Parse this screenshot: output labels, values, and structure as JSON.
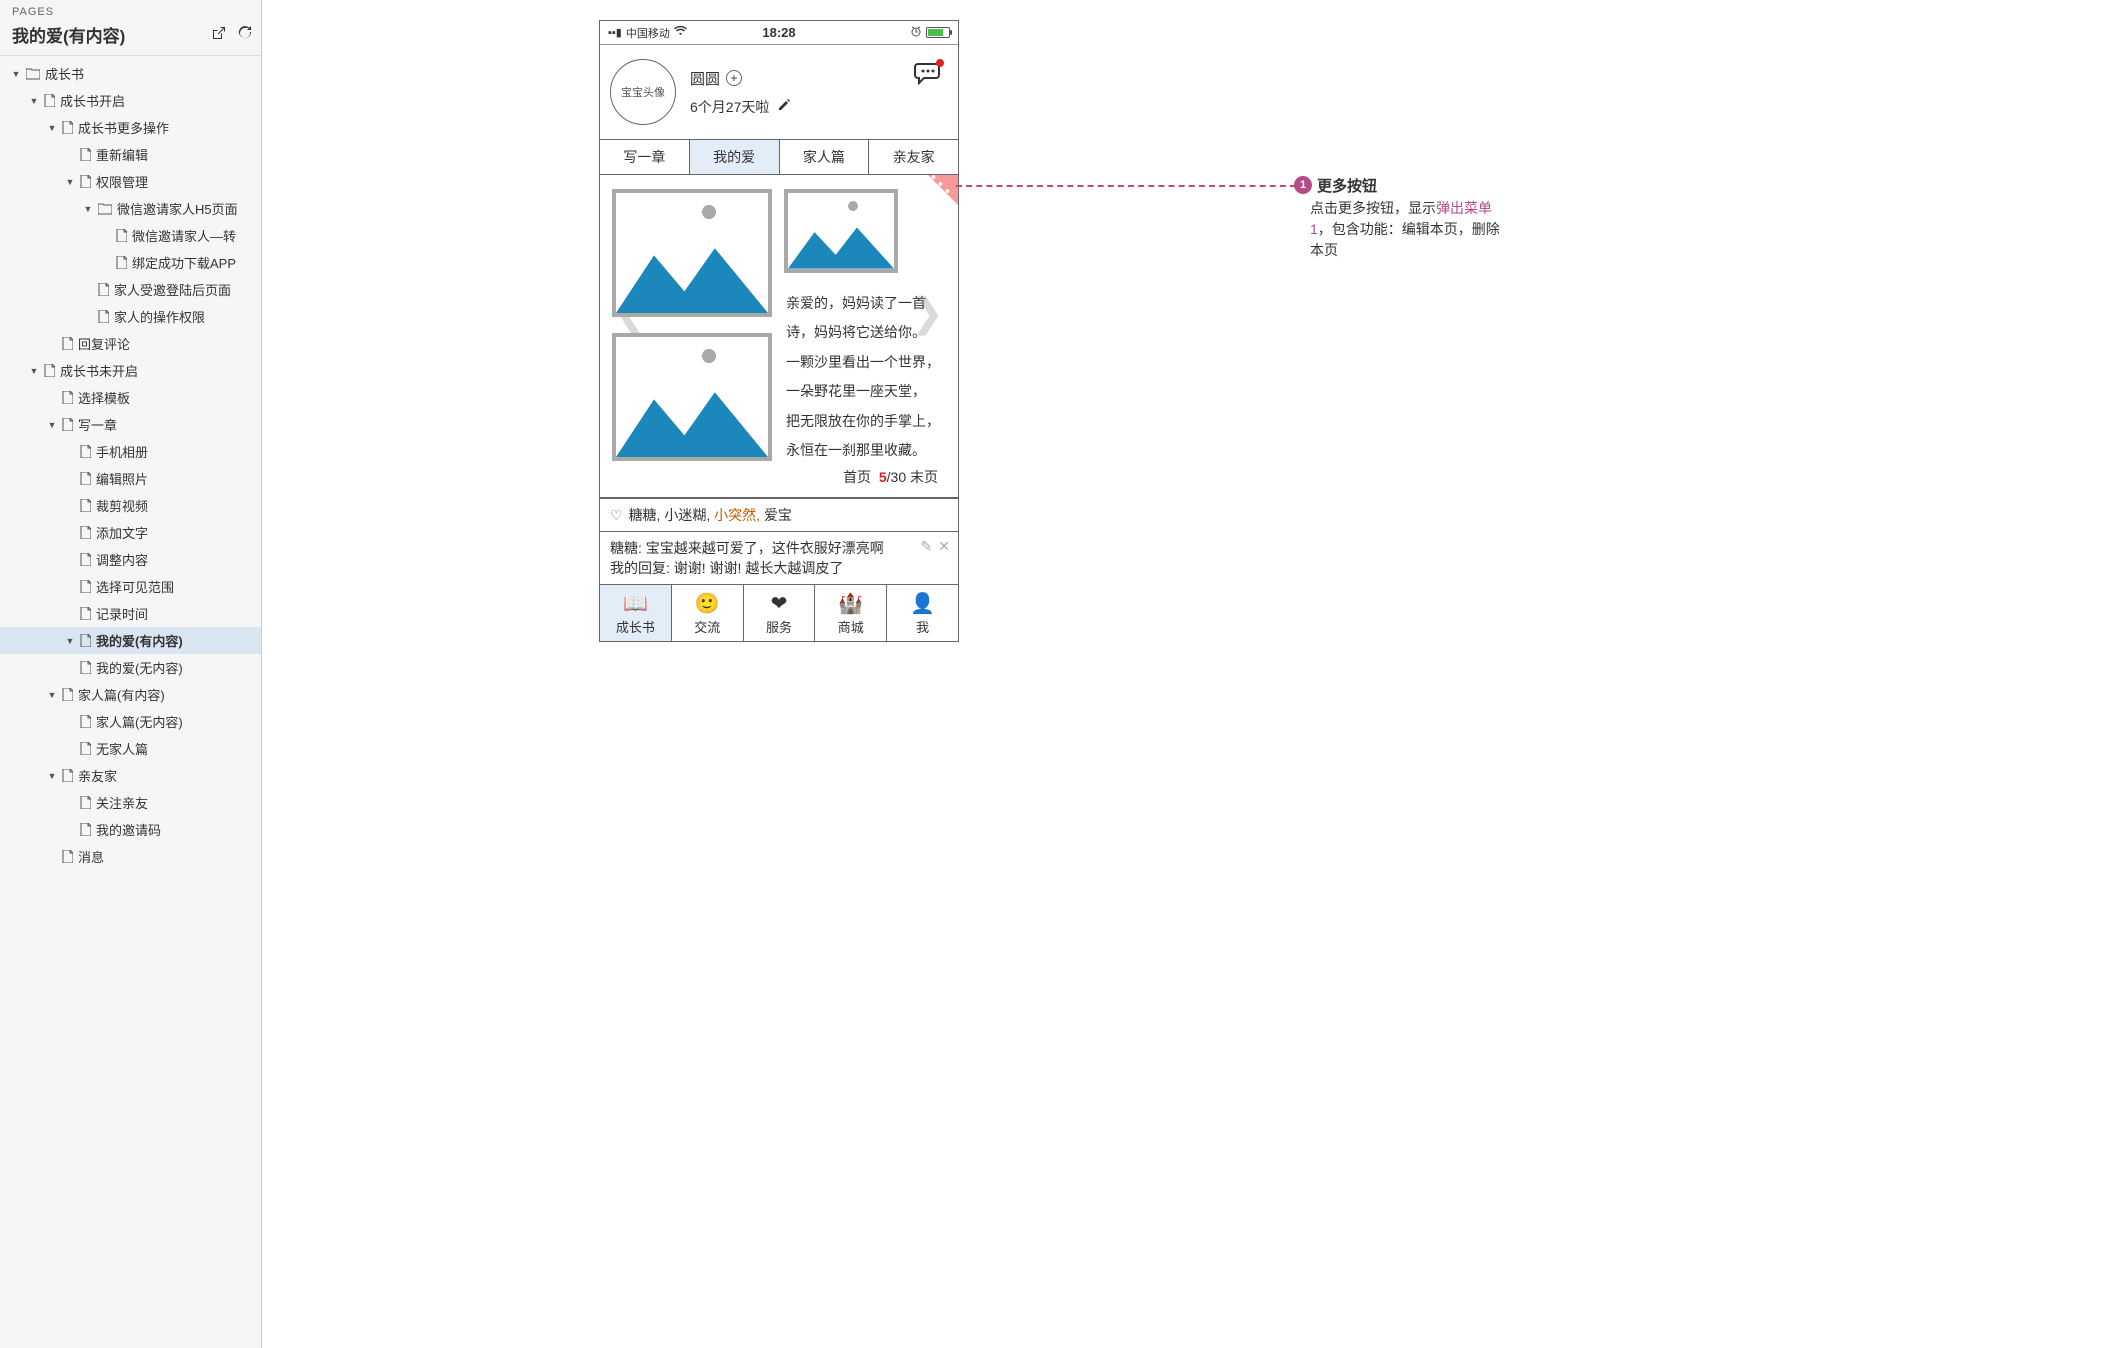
{
  "sidebar": {
    "header": "PAGES",
    "title": "我的爱(有内容)",
    "tree": [
      {
        "d": 0,
        "t": "folder",
        "label": "成长书",
        "exp": true
      },
      {
        "d": 1,
        "t": "page",
        "label": "成长书开启",
        "exp": true
      },
      {
        "d": 2,
        "t": "page",
        "label": "成长书更多操作",
        "exp": true
      },
      {
        "d": 3,
        "t": "page",
        "label": "重新编辑"
      },
      {
        "d": 3,
        "t": "page",
        "label": "权限管理",
        "exp": true
      },
      {
        "d": 4,
        "t": "folder",
        "label": "微信邀请家人H5页面",
        "exp": true
      },
      {
        "d": 5,
        "t": "page",
        "label": "微信邀请家人—转"
      },
      {
        "d": 5,
        "t": "page",
        "label": "绑定成功下载APP"
      },
      {
        "d": 4,
        "t": "page",
        "label": "家人受邀登陆后页面"
      },
      {
        "d": 4,
        "t": "page",
        "label": "家人的操作权限"
      },
      {
        "d": 2,
        "t": "page",
        "label": "回复评论"
      },
      {
        "d": 1,
        "t": "page",
        "label": "成长书未开启",
        "exp": true
      },
      {
        "d": 2,
        "t": "page",
        "label": "选择模板"
      },
      {
        "d": 2,
        "t": "page",
        "label": "写一章",
        "exp": true
      },
      {
        "d": 3,
        "t": "page",
        "label": "手机相册"
      },
      {
        "d": 3,
        "t": "page",
        "label": "编辑照片"
      },
      {
        "d": 3,
        "t": "page",
        "label": "裁剪视频"
      },
      {
        "d": 3,
        "t": "page",
        "label": "添加文字"
      },
      {
        "d": 3,
        "t": "page",
        "label": "调整内容"
      },
      {
        "d": 3,
        "t": "page",
        "label": "选择可见范围"
      },
      {
        "d": 3,
        "t": "page",
        "label": "记录时间"
      },
      {
        "d": 3,
        "t": "page",
        "label": "我的爱(有内容)",
        "exp": true,
        "selected": true
      },
      {
        "d": 3,
        "t": "page",
        "label": "我的爱(无内容)"
      },
      {
        "d": 2,
        "t": "page",
        "label": "家人篇(有内容)",
        "exp": true
      },
      {
        "d": 3,
        "t": "page",
        "label": "家人篇(无内容)"
      },
      {
        "d": 3,
        "t": "page",
        "label": "无家人篇"
      },
      {
        "d": 2,
        "t": "page",
        "label": "亲友家",
        "exp": true
      },
      {
        "d": 3,
        "t": "page",
        "label": "关注亲友"
      },
      {
        "d": 3,
        "t": "page",
        "label": "我的邀请码"
      },
      {
        "d": 2,
        "t": "page",
        "label": "消息"
      }
    ]
  },
  "phone": {
    "status": {
      "carrier": "中国移动",
      "time": "18:28"
    },
    "profile": {
      "avatar_text": "宝宝头像",
      "name": "圆圆",
      "age": "6个月27天啦"
    },
    "tabs": [
      "写一章",
      "我的爱",
      "家人篇",
      "亲友家"
    ],
    "poem": "亲爱的，妈妈读了一首诗，妈妈将它送给你。\n一颗沙里看出一个世界，\n一朵野花里一座天堂，\n把无限放在你的手掌上，\n永恒在一刹那里收藏。",
    "pager": {
      "first": "首页",
      "cur": "5",
      "total": "/30",
      "last": "末页"
    },
    "likes_prefix": "糖糖, 小迷糊,",
    "likes_hl": " 小突然,",
    "likes_suffix": " 爱宝",
    "comment1": "糖糖: 宝宝越来越可爱了，这件衣服好漂亮啊",
    "comment2": "我的回复: 谢谢! 谢谢! 越长大越调皮了",
    "nav": [
      "成长书",
      "交流",
      "服务",
      "商城",
      "我"
    ]
  },
  "annot": {
    "title": "更多按钮",
    "body_pre": "点击更多按钮，显示",
    "link": "弹出菜单1",
    "body_post": "，包含功能：编辑本页，删除本页"
  }
}
